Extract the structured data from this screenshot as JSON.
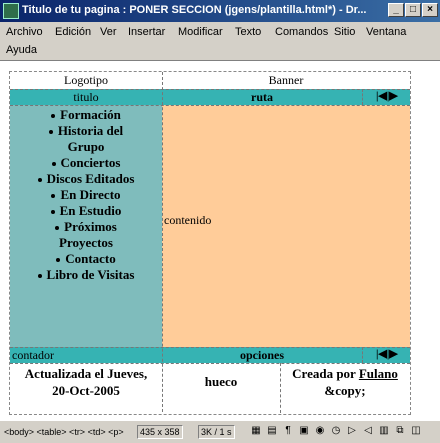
{
  "window": {
    "title": "Titulo de tu pagina : PONER SECCION (jgens/plantilla.html*) - Dr...",
    "minimize_glyph": "_",
    "maximize_glyph": "□",
    "close_glyph": "×"
  },
  "menu": {
    "items": [
      "Archivo",
      "Edición",
      "Ver",
      "Insertar",
      "Modificar",
      "Texto",
      "Comandos",
      "Sitio",
      "Ventana",
      "Ayuda"
    ]
  },
  "page": {
    "logo": "Logotipo",
    "banner": "Banner",
    "titulo": "titulo",
    "ruta": "ruta",
    "content": "contenido",
    "counter": "contador",
    "options": "opciones",
    "nav_arrows": "|◀|▶",
    "nav_items": [
      {
        "lines": [
          "Formación"
        ]
      },
      {
        "lines": [
          "Historia del",
          "Grupo"
        ]
      },
      {
        "lines": [
          "Conciertos"
        ]
      },
      {
        "lines": [
          "Discos Editados"
        ]
      },
      {
        "lines": [
          "En Directo"
        ]
      },
      {
        "lines": [
          "En Estudio"
        ]
      },
      {
        "lines": [
          "Próximos",
          "Proyectos"
        ]
      },
      {
        "lines": [
          "Contacto"
        ]
      },
      {
        "lines": [
          "Libro de Visitas"
        ]
      }
    ],
    "footer_left_1": "Actualizada el Jueves,",
    "footer_left_2": "20-Oct-2005",
    "footer_center": "hueco",
    "footer_right_prefix": "Creada por ",
    "footer_right_link": "Fulano",
    "footer_right_2": "&copy;"
  },
  "status": {
    "tags": "<body> <table> <tr> <td> <p>",
    "size": "435 x 358",
    "weight": "3K / 1 s"
  },
  "colors": {
    "teal": "#36b3b3",
    "sidebar": "#7fbcbc",
    "content": "#ffcc99"
  }
}
